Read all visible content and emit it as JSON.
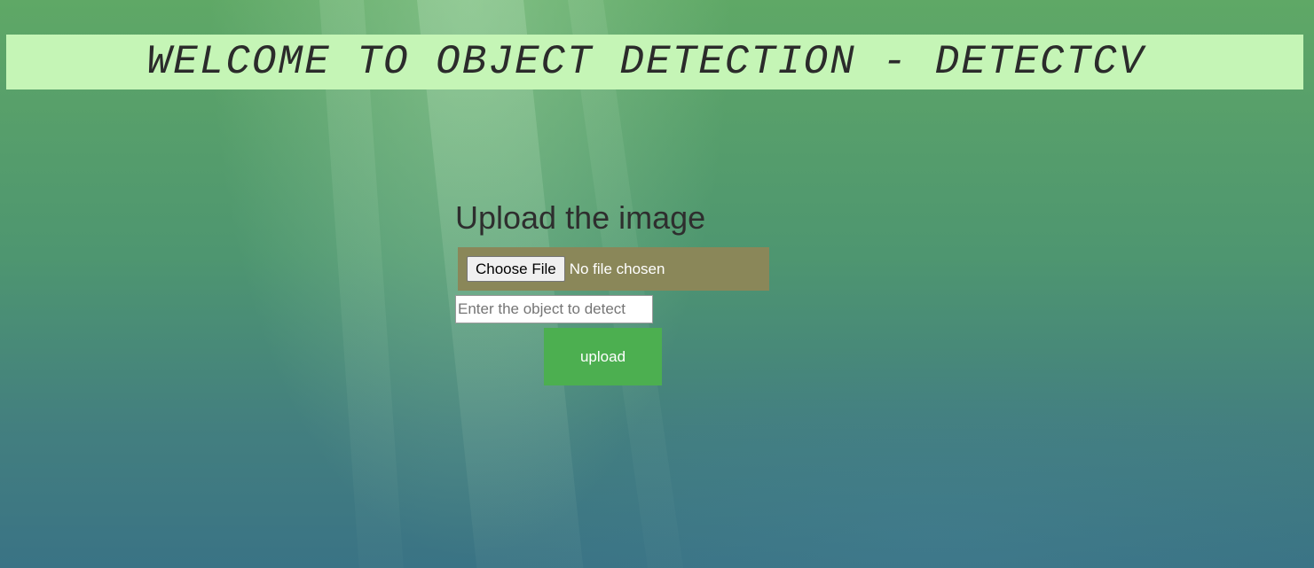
{
  "header": {
    "title": "WELCOME TO OBJECT DETECTION - DETECTCV"
  },
  "upload": {
    "heading": "Upload the image",
    "choose_file_label": "Choose File",
    "file_status": "No file chosen",
    "object_input": {
      "value": "",
      "placeholder": "Enter the object to detect"
    },
    "submit_label": "upload"
  },
  "colors": {
    "header_background": "#c5f5b6",
    "file_panel_background": "#8a8759",
    "upload_button": "#4caf50"
  }
}
